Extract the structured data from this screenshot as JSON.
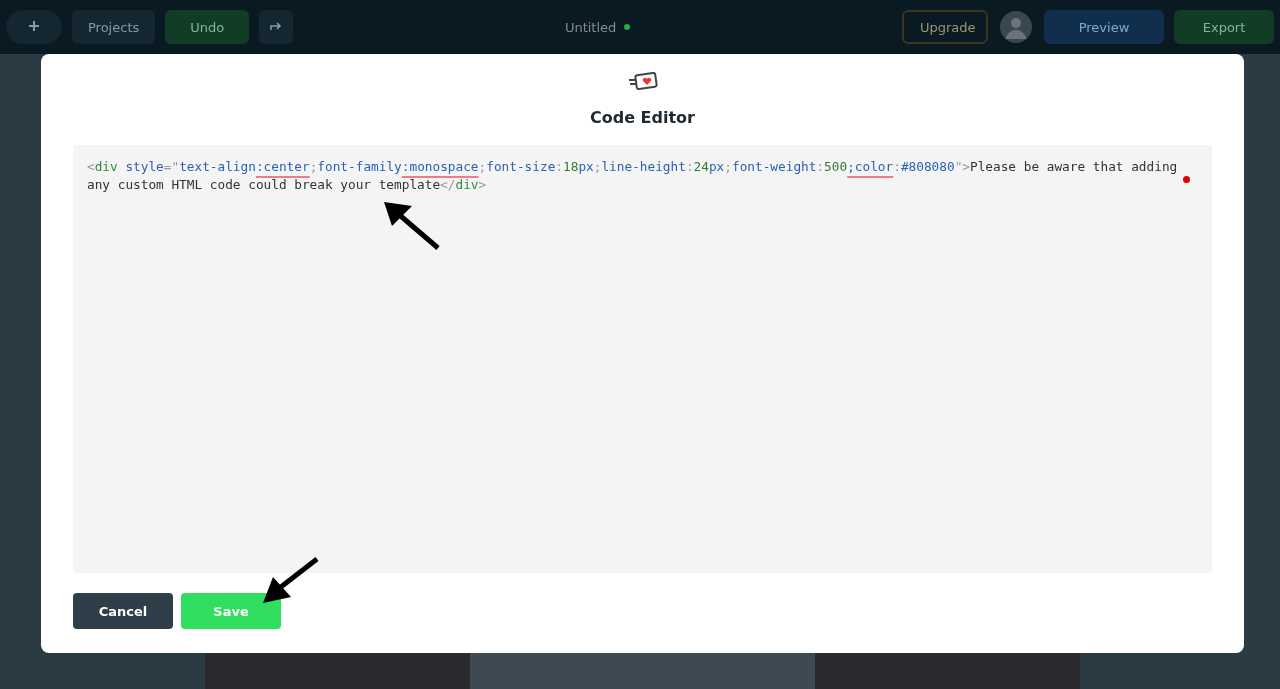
{
  "top_bar": {
    "projects": "Projects",
    "undo": "Undo",
    "title": "Untitled",
    "upgrade": "Upgrade",
    "preview": "Preview",
    "export": "Export"
  },
  "dialog": {
    "title": "Code Editor",
    "code_lines": [
      [
        {
          "kind": "punct",
          "text": "<"
        },
        {
          "kind": "tag",
          "text": "div"
        },
        {
          "kind": "prop",
          "text": " style"
        },
        {
          "kind": "punct",
          "text": "=\""
        },
        {
          "kind": "prop",
          "text": "text-align"
        },
        {
          "kind": "prop",
          "text": ":center",
          "flagged": true
        },
        {
          "kind": "punct",
          "text": ";"
        },
        {
          "kind": "prop",
          "text": "font-family"
        },
        {
          "kind": "prop",
          "text": ":monospace",
          "flagged": true
        },
        {
          "kind": "punct",
          "text": ";"
        },
        {
          "kind": "prop",
          "text": "font-size"
        },
        {
          "kind": "punct",
          "text": ":"
        },
        {
          "kind": "number",
          "text": "18"
        },
        {
          "kind": "prop",
          "text": "px"
        },
        {
          "kind": "punct",
          "text": ";"
        },
        {
          "kind": "prop",
          "text": "line-height"
        },
        {
          "kind": "punct",
          "text": ":"
        },
        {
          "kind": "number",
          "text": "24"
        },
        {
          "kind": "prop",
          "text": "px"
        },
        {
          "kind": "punct",
          "text": ";"
        },
        {
          "kind": "prop",
          "text": "font-weight"
        },
        {
          "kind": "punct",
          "text": ":"
        },
        {
          "kind": "number",
          "text": "500"
        },
        {
          "kind": "prop",
          "text": ";color",
          "flagged": true
        },
        {
          "kind": "punct",
          "text": ":"
        },
        {
          "kind": "prop",
          "text": "#808080"
        },
        {
          "kind": "punct",
          "text": "\">"
        },
        {
          "kind": "text",
          "text": "Please be aware that adding"
        }
      ],
      [
        {
          "kind": "text",
          "text": "any custom HTML code could break your template"
        },
        {
          "kind": "punct",
          "text": "</"
        },
        {
          "kind": "tag",
          "text": "div"
        },
        {
          "kind": "punct",
          "text": ">"
        }
      ]
    ],
    "buttons": [
      {
        "label": "Cancel",
        "kind": "secondary"
      },
      {
        "label": "Save",
        "kind": "primary"
      }
    ]
  }
}
